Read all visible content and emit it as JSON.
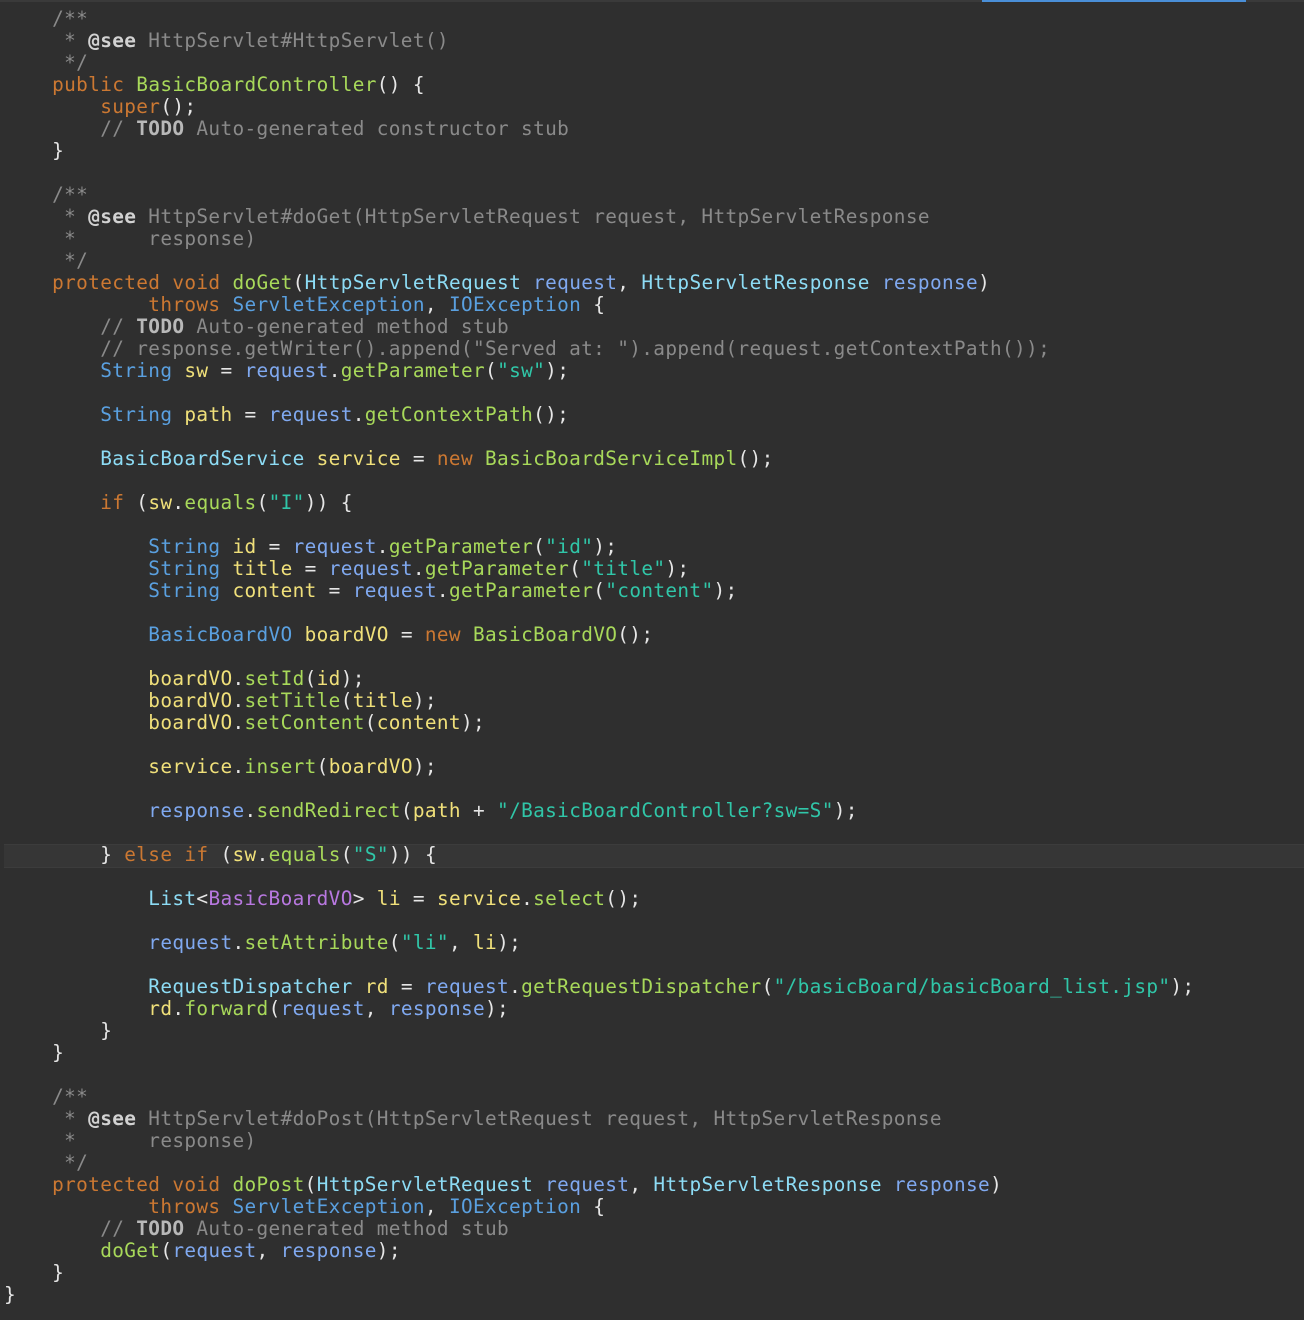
{
  "lines": [
    [
      {
        "t": "    ",
        "c": "plain"
      },
      {
        "t": "/**",
        "c": "comment"
      }
    ],
    [
      {
        "t": "     * ",
        "c": "comment"
      },
      {
        "t": "@see",
        "c": "tag"
      },
      {
        "t": " HttpServlet#HttpServlet()",
        "c": "comment"
      }
    ],
    [
      {
        "t": "     */",
        "c": "comment"
      }
    ],
    [
      {
        "t": "    ",
        "c": "plain"
      },
      {
        "t": "public",
        "c": "kw"
      },
      {
        "t": " ",
        "c": "plain"
      },
      {
        "t": "BasicBoardController",
        "c": "method"
      },
      {
        "t": "() {",
        "c": "punct"
      }
    ],
    [
      {
        "t": "        ",
        "c": "plain"
      },
      {
        "t": "super",
        "c": "kw"
      },
      {
        "t": "();",
        "c": "punct"
      }
    ],
    [
      {
        "t": "        // ",
        "c": "comment"
      },
      {
        "t": "TODO",
        "c": "todo"
      },
      {
        "t": " Auto-generated constructor stub",
        "c": "comment"
      }
    ],
    [
      {
        "t": "    }",
        "c": "punct"
      }
    ],
    [
      {
        "t": "",
        "c": "plain"
      }
    ],
    [
      {
        "t": "    ",
        "c": "plain"
      },
      {
        "t": "/**",
        "c": "comment"
      }
    ],
    [
      {
        "t": "     * ",
        "c": "comment"
      },
      {
        "t": "@see",
        "c": "tag"
      },
      {
        "t": " HttpServlet#doGet(HttpServletRequest request, HttpServletResponse",
        "c": "comment"
      }
    ],
    [
      {
        "t": "     *      response)",
        "c": "comment"
      }
    ],
    [
      {
        "t": "     */",
        "c": "comment"
      }
    ],
    [
      {
        "t": "    ",
        "c": "plain"
      },
      {
        "t": "protected",
        "c": "kw"
      },
      {
        "t": " ",
        "c": "plain"
      },
      {
        "t": "void",
        "c": "kw"
      },
      {
        "t": " ",
        "c": "plain"
      },
      {
        "t": "doGet",
        "c": "method"
      },
      {
        "t": "(",
        "c": "punct"
      },
      {
        "t": "HttpServletRequest",
        "c": "type"
      },
      {
        "t": " ",
        "c": "plain"
      },
      {
        "t": "request",
        "c": "param"
      },
      {
        "t": ", ",
        "c": "punct"
      },
      {
        "t": "HttpServletResponse",
        "c": "type"
      },
      {
        "t": " ",
        "c": "plain"
      },
      {
        "t": "response",
        "c": "param"
      },
      {
        "t": ")",
        "c": "punct"
      }
    ],
    [
      {
        "t": "            ",
        "c": "plain"
      },
      {
        "t": "throws",
        "c": "kw"
      },
      {
        "t": " ",
        "c": "plain"
      },
      {
        "t": "ServletException",
        "c": "ctype"
      },
      {
        "t": ", ",
        "c": "punct"
      },
      {
        "t": "IOException",
        "c": "ctype"
      },
      {
        "t": " {",
        "c": "punct"
      }
    ],
    [
      {
        "t": "        // ",
        "c": "comment"
      },
      {
        "t": "TODO",
        "c": "todo"
      },
      {
        "t": " Auto-generated method stub",
        "c": "comment"
      }
    ],
    [
      {
        "t": "        // response.getWriter().append(\"Served at: \").append(request.getContextPath());",
        "c": "comment"
      }
    ],
    [
      {
        "t": "        ",
        "c": "plain"
      },
      {
        "t": "String",
        "c": "ctype"
      },
      {
        "t": " ",
        "c": "plain"
      },
      {
        "t": "sw",
        "c": "var"
      },
      {
        "t": " = ",
        "c": "punct"
      },
      {
        "t": "request",
        "c": "param"
      },
      {
        "t": ".",
        "c": "punct"
      },
      {
        "t": "getParameter",
        "c": "method"
      },
      {
        "t": "(",
        "c": "punct"
      },
      {
        "t": "\"sw\"",
        "c": "str"
      },
      {
        "t": ");",
        "c": "punct"
      }
    ],
    [
      {
        "t": "",
        "c": "plain"
      }
    ],
    [
      {
        "t": "        ",
        "c": "plain"
      },
      {
        "t": "String",
        "c": "ctype"
      },
      {
        "t": " ",
        "c": "plain"
      },
      {
        "t": "path",
        "c": "var"
      },
      {
        "t": " = ",
        "c": "punct"
      },
      {
        "t": "request",
        "c": "param"
      },
      {
        "t": ".",
        "c": "punct"
      },
      {
        "t": "getContextPath",
        "c": "method"
      },
      {
        "t": "();",
        "c": "punct"
      }
    ],
    [
      {
        "t": "",
        "c": "plain"
      }
    ],
    [
      {
        "t": "        ",
        "c": "plain"
      },
      {
        "t": "BasicBoardService",
        "c": "type"
      },
      {
        "t": " ",
        "c": "plain"
      },
      {
        "t": "service",
        "c": "var"
      },
      {
        "t": " = ",
        "c": "punct"
      },
      {
        "t": "new",
        "c": "kw"
      },
      {
        "t": " ",
        "c": "plain"
      },
      {
        "t": "BasicBoardServiceImpl",
        "c": "method"
      },
      {
        "t": "();",
        "c": "punct"
      }
    ],
    [
      {
        "t": "",
        "c": "plain"
      }
    ],
    [
      {
        "t": "        ",
        "c": "plain"
      },
      {
        "t": "if",
        "c": "kw"
      },
      {
        "t": " (",
        "c": "punct"
      },
      {
        "t": "sw",
        "c": "var"
      },
      {
        "t": ".",
        "c": "punct"
      },
      {
        "t": "equals",
        "c": "method"
      },
      {
        "t": "(",
        "c": "punct"
      },
      {
        "t": "\"I\"",
        "c": "str"
      },
      {
        "t": ")) {",
        "c": "punct"
      }
    ],
    [
      {
        "t": "",
        "c": "plain"
      }
    ],
    [
      {
        "t": "            ",
        "c": "plain"
      },
      {
        "t": "String",
        "c": "ctype"
      },
      {
        "t": " ",
        "c": "plain"
      },
      {
        "t": "id",
        "c": "var"
      },
      {
        "t": " = ",
        "c": "punct"
      },
      {
        "t": "request",
        "c": "param"
      },
      {
        "t": ".",
        "c": "punct"
      },
      {
        "t": "getParameter",
        "c": "method"
      },
      {
        "t": "(",
        "c": "punct"
      },
      {
        "t": "\"id\"",
        "c": "str"
      },
      {
        "t": ");",
        "c": "punct"
      }
    ],
    [
      {
        "t": "            ",
        "c": "plain"
      },
      {
        "t": "String",
        "c": "ctype"
      },
      {
        "t": " ",
        "c": "plain"
      },
      {
        "t": "title",
        "c": "var"
      },
      {
        "t": " = ",
        "c": "punct"
      },
      {
        "t": "request",
        "c": "param"
      },
      {
        "t": ".",
        "c": "punct"
      },
      {
        "t": "getParameter",
        "c": "method"
      },
      {
        "t": "(",
        "c": "punct"
      },
      {
        "t": "\"title\"",
        "c": "str"
      },
      {
        "t": ");",
        "c": "punct"
      }
    ],
    [
      {
        "t": "            ",
        "c": "plain"
      },
      {
        "t": "String",
        "c": "ctype"
      },
      {
        "t": " ",
        "c": "plain"
      },
      {
        "t": "content",
        "c": "var"
      },
      {
        "t": " = ",
        "c": "punct"
      },
      {
        "t": "request",
        "c": "param"
      },
      {
        "t": ".",
        "c": "punct"
      },
      {
        "t": "getParameter",
        "c": "method"
      },
      {
        "t": "(",
        "c": "punct"
      },
      {
        "t": "\"content\"",
        "c": "str"
      },
      {
        "t": ");",
        "c": "punct"
      }
    ],
    [
      {
        "t": "",
        "c": "plain"
      }
    ],
    [
      {
        "t": "            ",
        "c": "plain"
      },
      {
        "t": "BasicBoardVO",
        "c": "ctype"
      },
      {
        "t": " ",
        "c": "plain"
      },
      {
        "t": "boardVO",
        "c": "var"
      },
      {
        "t": " = ",
        "c": "punct"
      },
      {
        "t": "new",
        "c": "kw"
      },
      {
        "t": " ",
        "c": "plain"
      },
      {
        "t": "BasicBoardVO",
        "c": "method"
      },
      {
        "t": "();",
        "c": "punct"
      }
    ],
    [
      {
        "t": "",
        "c": "plain"
      }
    ],
    [
      {
        "t": "            ",
        "c": "plain"
      },
      {
        "t": "boardVO",
        "c": "var"
      },
      {
        "t": ".",
        "c": "punct"
      },
      {
        "t": "setId",
        "c": "method"
      },
      {
        "t": "(",
        "c": "punct"
      },
      {
        "t": "id",
        "c": "var"
      },
      {
        "t": ");",
        "c": "punct"
      }
    ],
    [
      {
        "t": "            ",
        "c": "plain"
      },
      {
        "t": "boardVO",
        "c": "var"
      },
      {
        "t": ".",
        "c": "punct"
      },
      {
        "t": "setTitle",
        "c": "method"
      },
      {
        "t": "(",
        "c": "punct"
      },
      {
        "t": "title",
        "c": "var"
      },
      {
        "t": ");",
        "c": "punct"
      }
    ],
    [
      {
        "t": "            ",
        "c": "plain"
      },
      {
        "t": "boardVO",
        "c": "var"
      },
      {
        "t": ".",
        "c": "punct"
      },
      {
        "t": "setContent",
        "c": "method"
      },
      {
        "t": "(",
        "c": "punct"
      },
      {
        "t": "content",
        "c": "var"
      },
      {
        "t": ");",
        "c": "punct"
      }
    ],
    [
      {
        "t": "",
        "c": "plain"
      }
    ],
    [
      {
        "t": "            ",
        "c": "plain"
      },
      {
        "t": "service",
        "c": "var"
      },
      {
        "t": ".",
        "c": "punct"
      },
      {
        "t": "insert",
        "c": "method"
      },
      {
        "t": "(",
        "c": "punct"
      },
      {
        "t": "boardVO",
        "c": "var"
      },
      {
        "t": ");",
        "c": "punct"
      }
    ],
    [
      {
        "t": "",
        "c": "plain"
      }
    ],
    [
      {
        "t": "            ",
        "c": "plain"
      },
      {
        "t": "response",
        "c": "param"
      },
      {
        "t": ".",
        "c": "punct"
      },
      {
        "t": "sendRedirect",
        "c": "method"
      },
      {
        "t": "(",
        "c": "punct"
      },
      {
        "t": "path",
        "c": "var"
      },
      {
        "t": " + ",
        "c": "punct"
      },
      {
        "t": "\"/BasicBoardController?sw=S\"",
        "c": "str"
      },
      {
        "t": ");",
        "c": "punct"
      }
    ],
    [
      {
        "t": "",
        "c": "plain"
      }
    ],
    [
      {
        "t": "        } ",
        "c": "punct"
      },
      {
        "t": "else",
        "c": "kw"
      },
      {
        "t": " ",
        "c": "plain"
      },
      {
        "t": "if",
        "c": "kw"
      },
      {
        "t": " (",
        "c": "punct"
      },
      {
        "t": "sw",
        "c": "var"
      },
      {
        "t": ".",
        "c": "punct"
      },
      {
        "t": "equals",
        "c": "method"
      },
      {
        "t": "(",
        "c": "punct"
      },
      {
        "t": "\"S\"",
        "c": "str"
      },
      {
        "t": ")) {",
        "c": "punct"
      }
    ],
    [
      {
        "t": "",
        "c": "plain"
      }
    ],
    [
      {
        "t": "            ",
        "c": "plain"
      },
      {
        "t": "List",
        "c": "field"
      },
      {
        "t": "<",
        "c": "punct"
      },
      {
        "t": "BasicBoardVO",
        "c": "generic"
      },
      {
        "t": "> ",
        "c": "punct"
      },
      {
        "t": "li",
        "c": "var"
      },
      {
        "t": " = ",
        "c": "punct"
      },
      {
        "t": "service",
        "c": "var"
      },
      {
        "t": ".",
        "c": "punct"
      },
      {
        "t": "select",
        "c": "method"
      },
      {
        "t": "();",
        "c": "punct"
      }
    ],
    [
      {
        "t": "",
        "c": "plain"
      }
    ],
    [
      {
        "t": "            ",
        "c": "plain"
      },
      {
        "t": "request",
        "c": "param"
      },
      {
        "t": ".",
        "c": "punct"
      },
      {
        "t": "setAttribute",
        "c": "method"
      },
      {
        "t": "(",
        "c": "punct"
      },
      {
        "t": "\"li\"",
        "c": "str"
      },
      {
        "t": ", ",
        "c": "punct"
      },
      {
        "t": "li",
        "c": "var"
      },
      {
        "t": ");",
        "c": "punct"
      }
    ],
    [
      {
        "t": "",
        "c": "plain"
      }
    ],
    [
      {
        "t": "            ",
        "c": "plain"
      },
      {
        "t": "RequestDispatcher",
        "c": "type"
      },
      {
        "t": " ",
        "c": "plain"
      },
      {
        "t": "rd",
        "c": "var"
      },
      {
        "t": " = ",
        "c": "punct"
      },
      {
        "t": "request",
        "c": "param"
      },
      {
        "t": ".",
        "c": "punct"
      },
      {
        "t": "getRequestDispatcher",
        "c": "method"
      },
      {
        "t": "(",
        "c": "punct"
      },
      {
        "t": "\"/basicBoard/basicBoard_list.jsp\"",
        "c": "str"
      },
      {
        "t": ");",
        "c": "punct"
      }
    ],
    [
      {
        "t": "            ",
        "c": "plain"
      },
      {
        "t": "rd",
        "c": "var"
      },
      {
        "t": ".",
        "c": "punct"
      },
      {
        "t": "forward",
        "c": "method"
      },
      {
        "t": "(",
        "c": "punct"
      },
      {
        "t": "request",
        "c": "param"
      },
      {
        "t": ", ",
        "c": "punct"
      },
      {
        "t": "response",
        "c": "param"
      },
      {
        "t": ");",
        "c": "punct"
      }
    ],
    [
      {
        "t": "        }",
        "c": "punct"
      }
    ],
    [
      {
        "t": "    }",
        "c": "punct"
      }
    ],
    [
      {
        "t": "",
        "c": "plain"
      }
    ],
    [
      {
        "t": "    ",
        "c": "plain"
      },
      {
        "t": "/**",
        "c": "comment"
      }
    ],
    [
      {
        "t": "     * ",
        "c": "comment"
      },
      {
        "t": "@see",
        "c": "tag"
      },
      {
        "t": " HttpServlet#doPost(HttpServletRequest request, HttpServletResponse",
        "c": "comment"
      }
    ],
    [
      {
        "t": "     *      response)",
        "c": "comment"
      }
    ],
    [
      {
        "t": "     */",
        "c": "comment"
      }
    ],
    [
      {
        "t": "    ",
        "c": "plain"
      },
      {
        "t": "protected",
        "c": "kw"
      },
      {
        "t": " ",
        "c": "plain"
      },
      {
        "t": "void",
        "c": "kw"
      },
      {
        "t": " ",
        "c": "plain"
      },
      {
        "t": "doPost",
        "c": "method"
      },
      {
        "t": "(",
        "c": "punct"
      },
      {
        "t": "HttpServletRequest",
        "c": "type"
      },
      {
        "t": " ",
        "c": "plain"
      },
      {
        "t": "request",
        "c": "param"
      },
      {
        "t": ", ",
        "c": "punct"
      },
      {
        "t": "HttpServletResponse",
        "c": "type"
      },
      {
        "t": " ",
        "c": "plain"
      },
      {
        "t": "response",
        "c": "param"
      },
      {
        "t": ")",
        "c": "punct"
      }
    ],
    [
      {
        "t": "            ",
        "c": "plain"
      },
      {
        "t": "throws",
        "c": "kw"
      },
      {
        "t": " ",
        "c": "plain"
      },
      {
        "t": "ServletException",
        "c": "ctype"
      },
      {
        "t": ", ",
        "c": "punct"
      },
      {
        "t": "IOException",
        "c": "ctype"
      },
      {
        "t": " {",
        "c": "punct"
      }
    ],
    [
      {
        "t": "        // ",
        "c": "comment"
      },
      {
        "t": "TODO",
        "c": "todo"
      },
      {
        "t": " Auto-generated method stub",
        "c": "comment"
      }
    ],
    [
      {
        "t": "        ",
        "c": "plain"
      },
      {
        "t": "doGet",
        "c": "method"
      },
      {
        "t": "(",
        "c": "punct"
      },
      {
        "t": "request",
        "c": "param"
      },
      {
        "t": ", ",
        "c": "punct"
      },
      {
        "t": "response",
        "c": "param"
      },
      {
        "t": ");",
        "c": "punct"
      }
    ],
    [
      {
        "t": "    }",
        "c": "punct"
      }
    ],
    [
      {
        "t": "}",
        "c": "punct"
      }
    ]
  ]
}
